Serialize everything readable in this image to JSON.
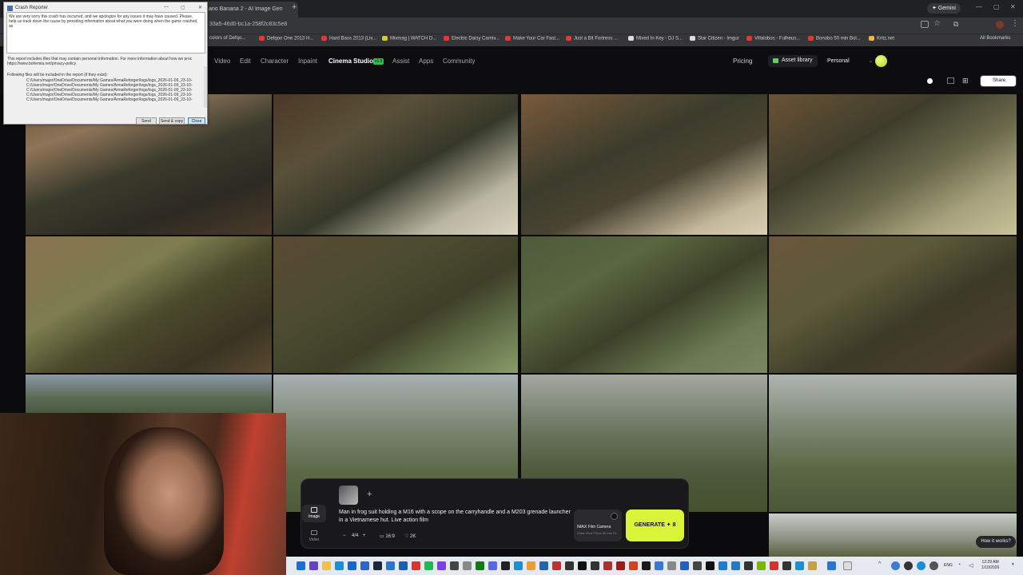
{
  "browser": {
    "active_tab": "ano Banana 2 - AI Image Gen",
    "url": "33a5-46d0-bc1a-258f2c83c5e8",
    "gemini": "Gemini",
    "bookmarks": [
      "colors of Defqo...",
      "Defqon One 2013 H...",
      "Hard Bass 2013 (Liv...",
      "Mixmag | WATCH D...",
      "Electric Daisy Carniv...",
      "Make Your Car Fast...",
      "Just a Bit Fortress ...",
      "Mixed In Key - DJ S...",
      "Star Citizen - Imgur",
      "Villalobos - Fulheus...",
      "Bonobo 50 min Bol...",
      "Kritz.net",
      "All Bookmarks"
    ]
  },
  "site": {
    "nav": [
      "Video",
      "Edit",
      "Character",
      "Inpaint",
      "Cinema Studio",
      "Assist",
      "Apps",
      "Community"
    ],
    "version_badge": "v1.5",
    "pricing": "Pricing",
    "asset_library": "Asset library",
    "workspace": "Personal",
    "share": "Share"
  },
  "crash": {
    "title": "Crash Reporter",
    "intro": "We are very sorry this crash has occurred, and we apologize for any issues it may have caused. Please, help us track down the cause by providing information about what you were doing when the game crashed, as",
    "privacy": "This report includes files that may contain personal information. For more information about how we proc",
    "privacy_url": "https://www.bohemia.net/privacy-policy",
    "files_header": "Following files will be included in the report (if they exist):",
    "files": [
      "C:/Users/major/OneDrive/Documents/My Games/ArmaReforger/logs/logs_2026-01-09_23-10-",
      "C:/Users/major/OneDrive/Documents/My Games/ArmaReforger/logs/logs_2026-01-09_23-10-",
      "C:/Users/major/OneDrive/Documents/My Games/ArmaReforger/logs/logs_2026-01-09_23-10-",
      "C:/Users/major/OneDrive/Documents/My Games/ArmaReforger/logs/logs_2026-01-09_23-10-",
      "C:/Users/major/OneDrive/Documents/My Games/ArmaReforger/logs/logs_2026-01-09_23-10-"
    ],
    "btn_send": "Send",
    "btn_send_copy": "Send & copy",
    "btn_close": "Close"
  },
  "prompt": {
    "text": "Man in frog suit holding a M16 with a scope on the carryhandle and a M203 grenade launcher in a Vietnamese hut. Live action film",
    "mode_image": "Image",
    "mode_video": "Video",
    "count": "4/4",
    "ratio": "16:9",
    "quality": "2K",
    "camera_name": "IMAX Film Camera",
    "camera_sub": "Zeiss Ultra Prime 50 mm f/4",
    "generate": "GENERATE ✦ 8",
    "how_it_works": "How it works?"
  },
  "taskbar": {
    "lang": "ENG",
    "time": "12:29 AM",
    "date": "1/10/2026"
  }
}
